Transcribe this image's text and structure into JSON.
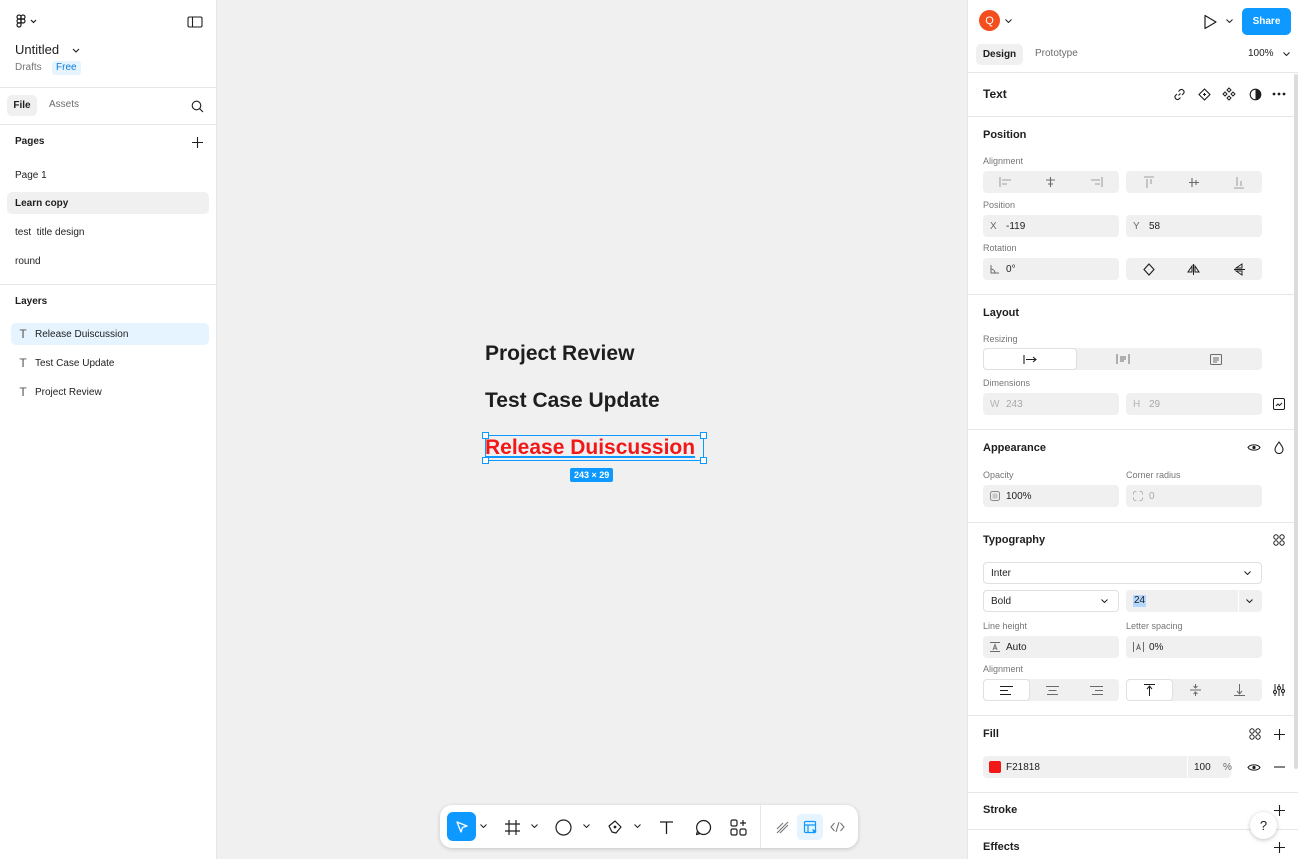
{
  "left_panel": {
    "file_name": "Untitled",
    "location": "Drafts",
    "plan_badge": "Free",
    "tabs": {
      "file": "File",
      "assets": "Assets"
    },
    "pages_heading": "Pages",
    "pages": [
      {
        "label": "Page 1",
        "selected": false
      },
      {
        "label": "Learn copy",
        "selected": true
      },
      {
        "label": "test  title design",
        "selected": false
      },
      {
        "label": "round",
        "selected": false
      }
    ],
    "layers_heading": "Layers",
    "layers": [
      {
        "label": "Release Duiscussion",
        "selected": true,
        "icon": "text-icon"
      },
      {
        "label": "Test Case Update",
        "selected": false,
        "icon": "text-icon"
      },
      {
        "label": "Project Review",
        "selected": false,
        "icon": "text-icon"
      }
    ]
  },
  "canvas": {
    "texts": [
      "Project Review",
      "Test Case Update",
      "Release Duiscussion"
    ],
    "selected_color": "#F21818",
    "dimension_badge": "243 × 29"
  },
  "right_panel": {
    "avatar_letter": "Q",
    "share_label": "Share",
    "tabs": {
      "design": "Design",
      "prototype": "Prototype"
    },
    "zoom": "100%",
    "selection_type": "Text",
    "position": {
      "heading": "Position",
      "alignment_label": "Alignment",
      "position_label": "Position",
      "x_prefix": "X",
      "x": "-119",
      "y_prefix": "Y",
      "y": "58",
      "rotation_label": "Rotation",
      "rotation": "0°"
    },
    "layout": {
      "heading": "Layout",
      "resizing_label": "Resizing",
      "dimensions_label": "Dimensions",
      "w_prefix": "W",
      "w": "243",
      "h_prefix": "H",
      "h": "29"
    },
    "appearance": {
      "heading": "Appearance",
      "opacity_label": "Opacity",
      "opacity": "100%",
      "radius_label": "Corner radius",
      "radius": "0"
    },
    "typography": {
      "heading": "Typography",
      "font_family": "Inter",
      "font_weight": "Bold",
      "font_size": "24",
      "line_height_label": "Line height",
      "line_height": "Auto",
      "letter_spacing_label": "Letter spacing",
      "letter_spacing": "0%",
      "alignment_label": "Alignment"
    },
    "fill": {
      "heading": "Fill",
      "color_hex": "F21818",
      "swatch": "#F21818",
      "opacity": "100",
      "unit": "%"
    },
    "stroke_heading": "Stroke",
    "effects_heading": "Effects",
    "help": "?"
  },
  "colors": {
    "accent": "#0d99ff",
    "selection_fill": "#e5f4ff",
    "avatar": "#f24e1e"
  }
}
